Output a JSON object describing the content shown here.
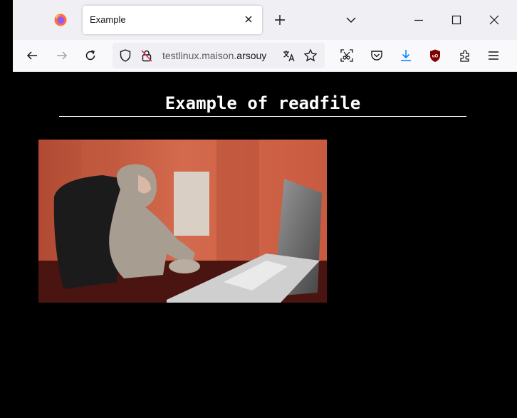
{
  "browser": {
    "tab": {
      "title": "Example"
    },
    "url": {
      "prefix": "testlinux.maison.",
      "host": "arsouy"
    }
  },
  "page": {
    "heading": "Example of readfile"
  },
  "icons": [
    "firefox-logo-icon",
    "close-icon",
    "plus-icon",
    "chevron-down-icon",
    "minimize-icon",
    "maximize-icon",
    "close-icon",
    "back-arrow-icon",
    "forward-arrow-icon",
    "reload-icon",
    "shield-icon",
    "lock-off-icon",
    "translate-icon",
    "star-icon",
    "screenshot-icon",
    "pocket-icon",
    "download-icon",
    "ublock-icon",
    "extensions-icon",
    "menu-icon"
  ],
  "colors": {
    "download_accent": "#0a84ff",
    "ublock_red": "#800000",
    "page_background": "#000000"
  }
}
